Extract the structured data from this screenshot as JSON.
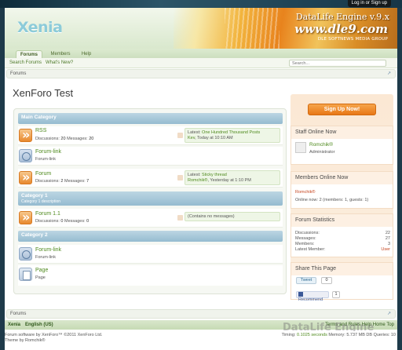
{
  "top_bar": {
    "login_label": "Log in or Sign up"
  },
  "header": {
    "logo": "Xenia",
    "banner_title": "DataLife Engine v.9.x",
    "banner_url": "www.dle9.com",
    "banner_sub": "DLE SOFTNEWS MEDIA GROUP"
  },
  "nav": {
    "tabs": [
      {
        "label": "Forums"
      },
      {
        "label": "Members"
      },
      {
        "label": "Help"
      }
    ],
    "sub_links": [
      {
        "label": "Search Forums"
      },
      {
        "label": "What's New?"
      }
    ],
    "search_placeholder": "Search..."
  },
  "breadcrumb": {
    "label": "Forums"
  },
  "page_title": "XenForo Test",
  "categories": [
    {
      "title": "Main Category",
      "description": ""
    },
    {
      "title": "Category 1",
      "description": "Category 1 description"
    },
    {
      "title": "Category 2",
      "description": ""
    }
  ],
  "forums": [
    {
      "name": "RSS",
      "discussions_label": "Discussions:",
      "discussions": "20",
      "messages_label": "Messages:",
      "messages": "20",
      "latest_prefix": "Latest:",
      "latest_title": "One Hundred Thousand Posts",
      "latest_user": "Kev",
      "latest_time": ", Today at 10:10 AM"
    },
    {
      "name": "Forum-link",
      "sub": "Forum-link"
    },
    {
      "name": "Forum",
      "discussions_label": "Discussions:",
      "discussions": "2",
      "messages_label": "Messages:",
      "messages": "7",
      "latest_prefix": "Latest:",
      "latest_title": "Sticky thread",
      "latest_user": "Romchik®",
      "latest_time": ", Yesterday at 1:10 PM"
    },
    {
      "name": "Forum 1.1",
      "discussions_label": "Discussions:",
      "discussions": "0",
      "messages_label": "Messages:",
      "messages": "0",
      "empty_label": "(Contains no messages)"
    },
    {
      "name": "Forum-link",
      "sub": "Forum-link"
    },
    {
      "name": "Page",
      "sub": "Page"
    }
  ],
  "sidebar": {
    "signup_label": "Sign Up Now!",
    "staff": {
      "title": "Staff Online Now",
      "name": "Romchik®",
      "role": "Administrator"
    },
    "members": {
      "title": "Members Online Now",
      "name": "Romchik®",
      "summary": "Online now: 2 (members: 1, guests: 1)"
    },
    "stats": {
      "title": "Forum Statistics",
      "rows": [
        {
          "label": "Discussions:",
          "value": "22"
        },
        {
          "label": "Messages:",
          "value": "27"
        },
        {
          "label": "Members:",
          "value": "3"
        },
        {
          "label": "Latest Member:",
          "value": "User"
        }
      ]
    },
    "share": {
      "title": "Share This Page",
      "tweet_label": "Tweet",
      "tweet_count": "0",
      "recommend_label": "Recommend",
      "recommend_count": "1"
    }
  },
  "footer": {
    "crumb": "Forums",
    "style_link": "Xenia",
    "lang_link": "English (US)",
    "right_links": "Terms and Rules    Help    Home    Top",
    "watermark": "DataLife Engine",
    "copyright": "Forum software by XenForo™ ©2011 XenForo Ltd.",
    "theme_by": "Theme by Romchik®",
    "timing_label": "Timing:",
    "timing_value": "0.1025 seconds",
    "memory": "Memory: 5.737 MB DB Queries: 10"
  }
}
